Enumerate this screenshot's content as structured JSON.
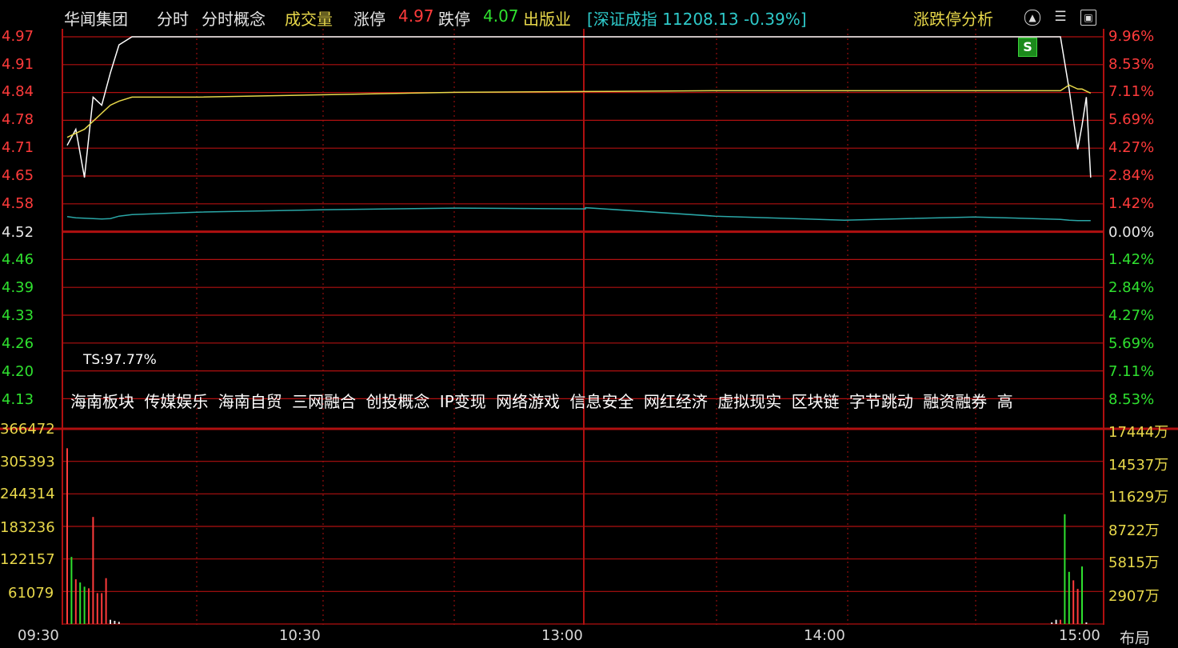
{
  "header": {
    "stock_name": "华闻集团",
    "tab_minute": "分时",
    "tab_concepts": "分时概念",
    "tab_volume": "成交量",
    "limit_up_label": "涨停",
    "limit_up_value": "4.97",
    "limit_down_label": "跌停",
    "limit_down_value": "4.07",
    "sector": "出版业",
    "index_info": "[深证成指 11208.13 -0.39%]",
    "analysis_button": "涨跌停分析",
    "icon_names": [
      "up-arrow-circle-icon",
      "menu-icon",
      "window-icon"
    ]
  },
  "price_axis": {
    "left_labels": [
      "4.97",
      "4.91",
      "4.84",
      "4.78",
      "4.71",
      "4.65",
      "4.58",
      "4.52",
      "4.46",
      "4.39",
      "4.33",
      "4.26",
      "4.20",
      "4.13"
    ],
    "right_labels": [
      "9.96%",
      "8.53%",
      "7.11%",
      "5.69%",
      "4.27%",
      "2.84%",
      "1.42%",
      "0.00%",
      "1.42%",
      "2.84%",
      "4.27%",
      "5.69%",
      "7.11%",
      "8.53%"
    ]
  },
  "volume_axis": {
    "left_labels": [
      "366472",
      "305393",
      "244314",
      "183236",
      "122157",
      "61079"
    ],
    "right_labels": [
      "17444万",
      "14537万",
      "11629万",
      "8722万",
      "5815万",
      "2907万"
    ]
  },
  "ts_text": "TS:97.77%",
  "badge": "S",
  "concepts": [
    "海南板块",
    "传媒娱乐",
    "海南自贸",
    "三网融合",
    "创投概念",
    "IP变现",
    "网络游戏",
    "信息安全",
    "网红经济",
    "虚拟现实",
    "区块链",
    "字节跳动",
    "融资融券",
    "高"
  ],
  "time_axis": [
    "09:30",
    "10:30",
    "13:00",
    "14:00",
    "15:00"
  ],
  "layout_button": "布局",
  "colors": {
    "up": "#ff3b3b",
    "down": "#2fe12f",
    "grid": "#b01010",
    "price_line": "#ffffff",
    "avg_line": "#e8d84a",
    "index_line": "#2aa7a7"
  },
  "chart_data": [
    {
      "type": "line",
      "title": "",
      "xlabel": "",
      "ylabel": "",
      "x": [
        "09:30",
        "09:32",
        "09:34",
        "09:36",
        "09:38",
        "09:40",
        "09:42",
        "09:45",
        "09:50",
        "10:00",
        "10:30",
        "11:00",
        "11:30",
        "13:00",
        "13:30",
        "14:00",
        "14:30",
        "14:50",
        "14:52",
        "14:54",
        "14:55",
        "14:56",
        "14:57"
      ],
      "ylim": [
        4.07,
        4.97
      ],
      "series": [
        {
          "name": "价格",
          "values": [
            4.7,
            4.74,
            4.62,
            4.82,
            4.8,
            4.88,
            4.95,
            4.97,
            4.97,
            4.97,
            4.97,
            4.97,
            4.97,
            4.97,
            4.97,
            4.97,
            4.97,
            4.97,
            4.84,
            4.69,
            4.75,
            4.82,
            4.62
          ]
        },
        {
          "name": "均价",
          "values": [
            4.72,
            4.73,
            4.74,
            4.76,
            4.78,
            4.8,
            4.81,
            4.82,
            4.82,
            4.82,
            4.826,
            4.832,
            4.834,
            4.834,
            4.836,
            4.836,
            4.836,
            4.836,
            4.85,
            4.84,
            4.84,
            4.835,
            4.83
          ]
        },
        {
          "name": "深证成指",
          "values": [
            4.523,
            4.52,
            4.519,
            4.518,
            4.517,
            4.518,
            4.524,
            4.528,
            4.53,
            4.534,
            4.54,
            4.544,
            4.542,
            4.545,
            4.524,
            4.514,
            4.522,
            4.516,
            4.514,
            4.513,
            4.513,
            4.513,
            4.513
          ]
        }
      ]
    },
    {
      "type": "bar",
      "title": "",
      "xlabel": "",
      "ylabel": "",
      "ylim": [
        0,
        366472
      ],
      "x": [
        "09:30",
        "09:31",
        "09:32",
        "09:33",
        "09:34",
        "09:35",
        "09:36",
        "09:37",
        "09:38",
        "09:39",
        "09:40",
        "09:41",
        "09:42",
        "14:48",
        "14:49",
        "14:50",
        "14:51",
        "14:52",
        "14:53",
        "14:54",
        "14:55",
        "14:56"
      ],
      "values": [
        330000,
        126000,
        84000,
        78000,
        70000,
        67000,
        201000,
        58000,
        58000,
        86000,
        8000,
        6000,
        4000,
        3000,
        8000,
        8000,
        206000,
        98000,
        82000,
        66000,
        108000,
        3000
      ],
      "colors": [
        "red",
        "green",
        "red",
        "green",
        "green",
        "red",
        "red",
        "red",
        "red",
        "red",
        "white",
        "white",
        "white",
        "white",
        "white",
        "red",
        "green",
        "green",
        "red",
        "red",
        "green",
        "white"
      ]
    }
  ]
}
